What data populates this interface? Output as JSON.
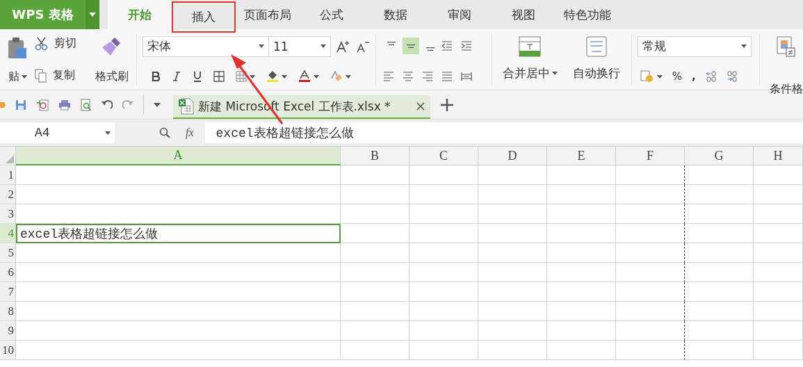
{
  "app": {
    "logo": "WPS 表格"
  },
  "tabs": [
    {
      "label": "开始",
      "selected": true,
      "highlighted": false
    },
    {
      "label": "插入",
      "selected": false,
      "highlighted": true
    },
    {
      "label": "页面布局",
      "selected": false,
      "highlighted": false
    },
    {
      "label": "公式",
      "selected": false,
      "highlighted": false
    },
    {
      "label": "数据",
      "selected": false,
      "highlighted": false
    },
    {
      "label": "审阅",
      "selected": false,
      "highlighted": false
    },
    {
      "label": "视图",
      "selected": false,
      "highlighted": false
    },
    {
      "label": "特色功能",
      "selected": false,
      "highlighted": false
    }
  ],
  "clipboard": {
    "paste": "贴",
    "cut": "剪切",
    "copy": "复制",
    "format_painter": "格式刷"
  },
  "font": {
    "name": "宋体",
    "size": "11"
  },
  "vertical_align": [
    {
      "selected": false
    },
    {
      "selected": true
    },
    {
      "selected": false
    }
  ],
  "merge": {
    "merge_center": "合并居中",
    "wrap_text": "自动换行"
  },
  "number": {
    "format": "常规",
    "percent": "%",
    "comma": ","
  },
  "conditional_format": "条件格",
  "document_tab": {
    "title": "新建 Microsoft Excel 工作表.xlsx *"
  },
  "formula_bar": {
    "cell_ref": "A4",
    "fx": "fx",
    "value": "excel表格超链接怎么做"
  },
  "sheet": {
    "columns": [
      {
        "label": "A",
        "selected": true
      },
      {
        "label": "B",
        "selected": false
      },
      {
        "label": "C",
        "selected": false
      },
      {
        "label": "D",
        "selected": false
      },
      {
        "label": "E",
        "selected": false
      },
      {
        "label": "F",
        "selected": false
      },
      {
        "label": "G",
        "selected": false
      },
      {
        "label": "H",
        "selected": false
      }
    ],
    "rows": [
      {
        "label": "1",
        "selected": false,
        "a": ""
      },
      {
        "label": "2",
        "selected": false,
        "a": ""
      },
      {
        "label": "3",
        "selected": false,
        "a": ""
      },
      {
        "label": "4",
        "selected": true,
        "a": "excel表格超链接怎么做"
      },
      {
        "label": "5",
        "selected": false,
        "a": ""
      },
      {
        "label": "6",
        "selected": false,
        "a": ""
      },
      {
        "label": "7",
        "selected": false,
        "a": ""
      },
      {
        "label": "8",
        "selected": false,
        "a": ""
      },
      {
        "label": "9",
        "selected": false,
        "a": ""
      },
      {
        "label": "10",
        "selected": false,
        "a": ""
      }
    ]
  }
}
